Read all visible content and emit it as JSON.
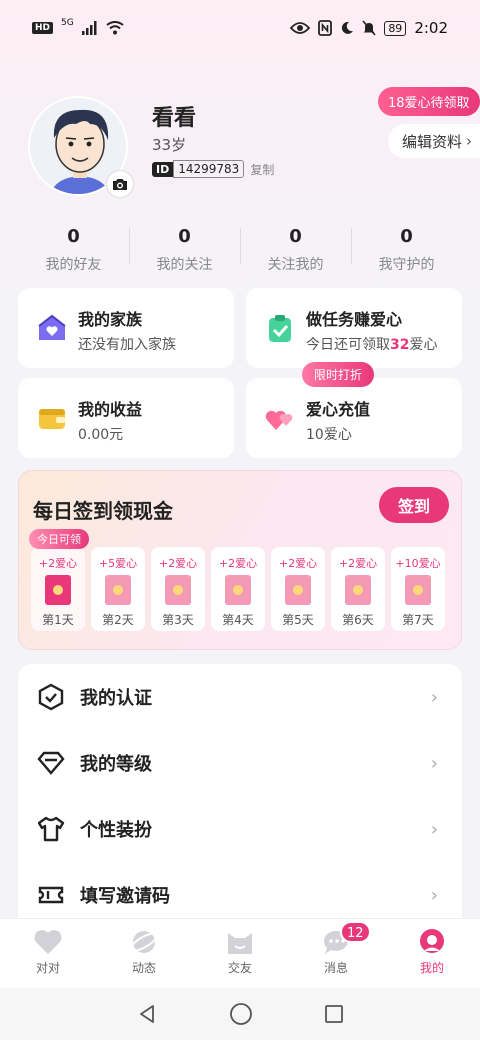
{
  "status_bar": {
    "network_left": "HD",
    "signal": "5G",
    "battery": "89",
    "time": "2:02"
  },
  "profile": {
    "name": "看看",
    "age": "33岁",
    "id_tag": "ID",
    "id_value": "14299783",
    "copy_label": "复制",
    "pending_label": "18爱心待领取",
    "edit_label": "编辑资料",
    "edit_chevron": "›"
  },
  "stats": [
    {
      "value": "0",
      "label": "我的好友"
    },
    {
      "value": "0",
      "label": "我的关注"
    },
    {
      "value": "0",
      "label": "关注我的"
    },
    {
      "value": "0",
      "label": "我守护的"
    }
  ],
  "cards": {
    "family": {
      "title": "我的家族",
      "sub": "还没有加入家族",
      "icon": "family-house-icon"
    },
    "tasks": {
      "title": "做任务赚爱心",
      "sub_prefix": "今日还可领取",
      "sub_highlight": "32",
      "sub_suffix": "爱心",
      "icon": "clipboard-check-icon"
    },
    "income": {
      "title": "我的收益",
      "sub": "0.00元",
      "icon": "wallet-icon"
    },
    "recharge": {
      "title": "爱心充值",
      "sub": "10爱心",
      "icon": "hearts-icon",
      "flash_label": "限时打折"
    }
  },
  "checkin": {
    "title": "每日签到领现金",
    "button": "签到",
    "today_label": "今日可领",
    "days": [
      {
        "reward": "+2爱心",
        "label": "第1天"
      },
      {
        "reward": "+5爱心",
        "label": "第2天"
      },
      {
        "reward": "+2爱心",
        "label": "第3天"
      },
      {
        "reward": "+2爱心",
        "label": "第4天"
      },
      {
        "reward": "+2爱心",
        "label": "第5天"
      },
      {
        "reward": "+2爱心",
        "label": "第6天"
      },
      {
        "reward": "+10爱心",
        "label": "第7天"
      }
    ]
  },
  "menu": [
    {
      "label": "我的认证",
      "icon": "certification-shield-icon"
    },
    {
      "label": "我的等级",
      "icon": "diamond-level-icon"
    },
    {
      "label": "个性装扮",
      "icon": "tshirt-icon"
    },
    {
      "label": "填写邀请码",
      "icon": "ticket-icon"
    }
  ],
  "menu_chevron": "›",
  "tabs": [
    {
      "label": "对对",
      "icon": "heart-tab-icon"
    },
    {
      "label": "动态",
      "icon": "planet-tab-icon"
    },
    {
      "label": "交友",
      "icon": "cat-face-tab-icon"
    },
    {
      "label": "消息",
      "icon": "chat-bubble-tab-icon",
      "badge": "12"
    },
    {
      "label": "我的",
      "icon": "profile-tab-icon",
      "active": true
    }
  ],
  "colors": {
    "accent": "#e8387a",
    "accent_light": "#f49ab7",
    "background": "#f4f4f8"
  }
}
